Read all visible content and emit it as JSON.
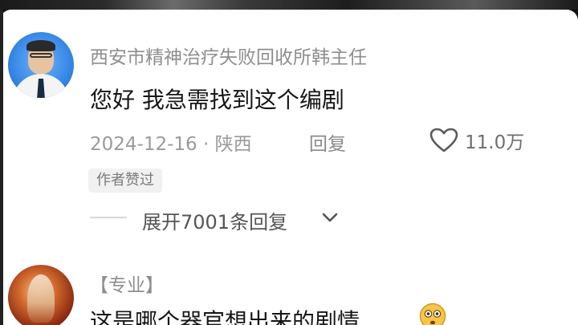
{
  "comments": [
    {
      "username": "西安市精神治疗失败回收所韩主任",
      "text": "您好 我急需找到这个编剧",
      "date_location": "2024-12-16 · 陕西",
      "reply_label": "回复",
      "like_count": "11.0万",
      "badge": "作者赞过",
      "expand_label": "展开7001条回复"
    },
    {
      "username": "【专业】",
      "text": "这是哪个器官想出来的剧情"
    }
  ],
  "icons": {
    "like": "heart-outline-icon",
    "expand": "chevron-down-icon",
    "emoji": "astonished-face-emoji"
  },
  "colors": {
    "background": "#ffffff",
    "username": "#8e8e8e",
    "content": "#161616",
    "meta": "#9a9a9a",
    "badge_bg": "#f1f1f1"
  }
}
